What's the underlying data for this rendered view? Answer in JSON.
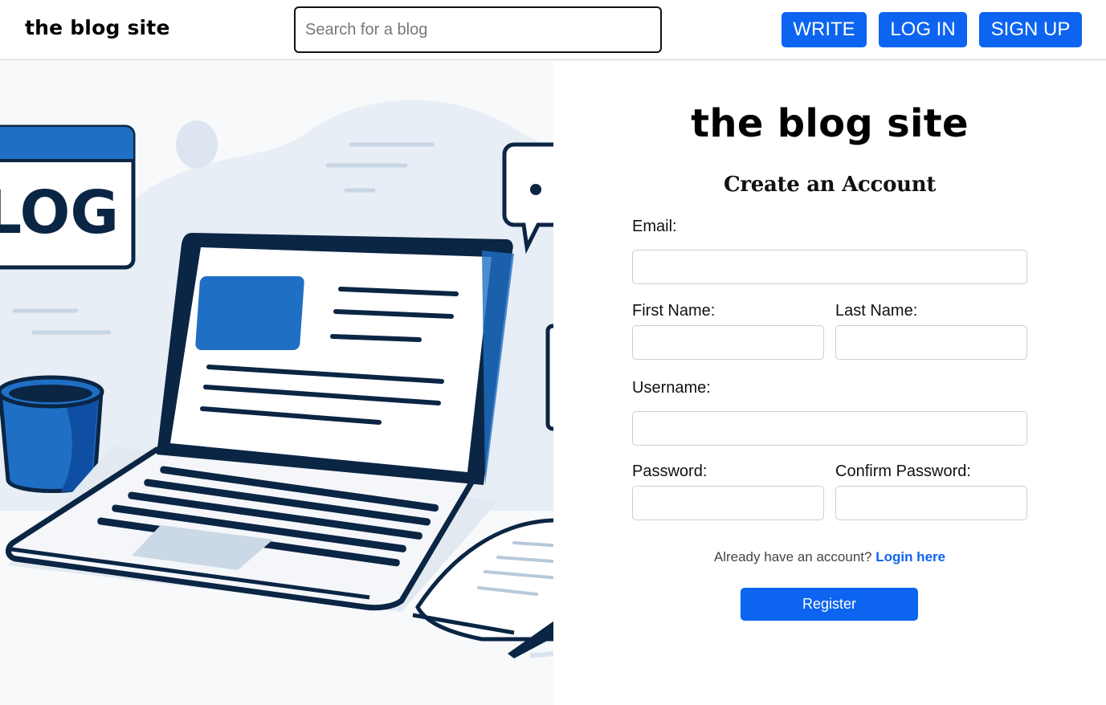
{
  "header": {
    "brand": "the blog site",
    "search_placeholder": "Search for a blog",
    "write_label": "WRITE",
    "login_label": "LOG IN",
    "signup_label": "SIGN UP"
  },
  "illustration": {
    "sign_text": "LOG"
  },
  "form": {
    "title": "the blog site",
    "subtitle": "Create an Account",
    "email_label": "Email:",
    "first_name_label": "First Name:",
    "last_name_label": "Last Name:",
    "username_label": "Username:",
    "password_label": "Password:",
    "confirm_password_label": "Confirm Password:",
    "already_text": "Already have an account?",
    "login_link": "Login here",
    "register_label": "Register"
  },
  "colors": {
    "accent": "#0d64f0",
    "navy": "#0b2544",
    "illustration_blue": "#1f6fc4"
  }
}
